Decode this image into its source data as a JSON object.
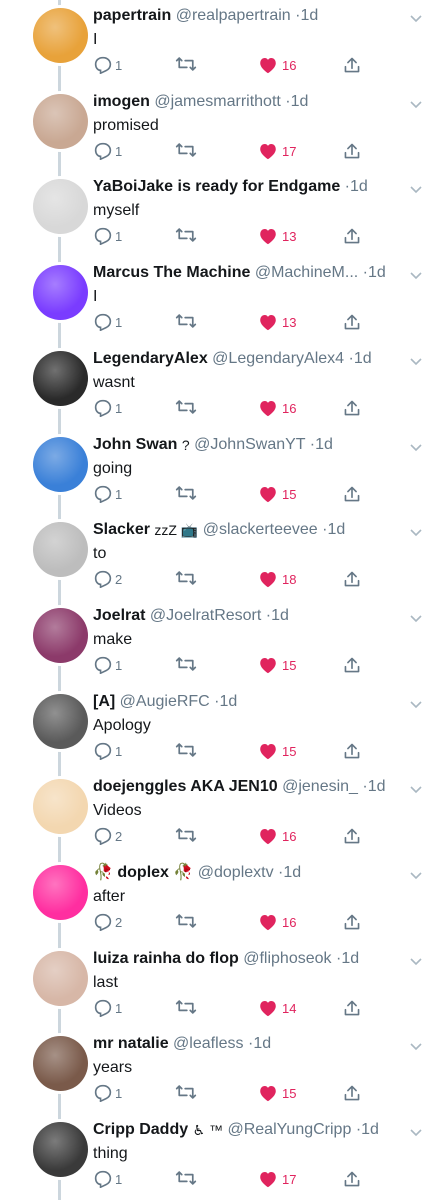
{
  "tweets": [
    {
      "name": "papertrain",
      "handle": "@realpapertrain",
      "time": "1d",
      "text": "I",
      "replies": "1",
      "likes": "16",
      "avatar_color": "#e8a23a"
    },
    {
      "name": "imogen",
      "handle": "@jamesmarrithott",
      "time": "1d",
      "text": "promised",
      "replies": "1",
      "likes": "17",
      "avatar_color": "#c9a893"
    },
    {
      "name": "YaBoiJake is ready for Endgame",
      "handle": "",
      "time": "1d",
      "text": "myself",
      "replies": "1",
      "likes": "13",
      "avatar_color": "#d8d8d8"
    },
    {
      "name": "Marcus The Machine",
      "handle": "@MachineM...",
      "time": "1d",
      "text": "I",
      "replies": "1",
      "likes": "13",
      "avatar_color": "#7a3cff"
    },
    {
      "name": "LegendaryAlex",
      "handle": "@LegendaryAlex4",
      "time": "1d",
      "text": "wasnt",
      "replies": "1",
      "likes": "16",
      "avatar_color": "#2a2a2a"
    },
    {
      "name": "John Swan",
      "handle": "@JohnSwanYT",
      "time": "1d",
      "text": "going",
      "replies": "1",
      "likes": "15",
      "avatar_color": "#3a80d8",
      "badge": "?"
    },
    {
      "name": "Slacker",
      "handle": "@slackerteevee",
      "time": "1d",
      "text": "to",
      "replies": "2",
      "likes": "18",
      "avatar_color": "#bdbdbd",
      "badge": "zzZ 📺"
    },
    {
      "name": "Joelrat",
      "handle": "@JoelratResort",
      "time": "1d",
      "text": "make",
      "replies": "1",
      "likes": "15",
      "avatar_color": "#8c3a6a"
    },
    {
      "name": "[A]",
      "handle": "@AugieRFC",
      "time": "1d",
      "text": "Apology",
      "replies": "1",
      "likes": "15",
      "avatar_color": "#5a5a5a"
    },
    {
      "name": "doejenggles AKA JEN10",
      "handle": "@jenesin_",
      "time": "1d",
      "text": "Videos",
      "replies": "2",
      "likes": "16",
      "avatar_color": "#f3d7b0"
    },
    {
      "name": "🥀 doplex 🥀",
      "handle": "@doplextv",
      "time": "1d",
      "text": "after",
      "replies": "2",
      "likes": "16",
      "avatar_color": "#ff2ea0"
    },
    {
      "name": "luiza rainha do flop",
      "handle": "@fliphoseok",
      "time": "1d",
      "text": "last",
      "replies": "1",
      "likes": "14",
      "avatar_color": "#d7b7a7"
    },
    {
      "name": "mr natalie",
      "handle": "@leafless",
      "time": "1d",
      "text": "years",
      "replies": "1",
      "likes": "15",
      "avatar_color": "#7a5a4a"
    },
    {
      "name": "Cripp Daddy",
      "handle": "@RealYungCripp",
      "time": "1d",
      "text": "thing",
      "replies": "1",
      "likes": "17",
      "avatar_color": "#3a3a3a",
      "badge": "♿ ™"
    }
  ],
  "icons": {
    "reply": "reply-icon",
    "retweet": "retweet-icon",
    "like": "heart-icon",
    "share": "share-icon",
    "caret": "chevron-down-icon"
  },
  "colors": {
    "like": "#e0245e",
    "muted": "#657786",
    "thread": "#ccd6dd"
  }
}
